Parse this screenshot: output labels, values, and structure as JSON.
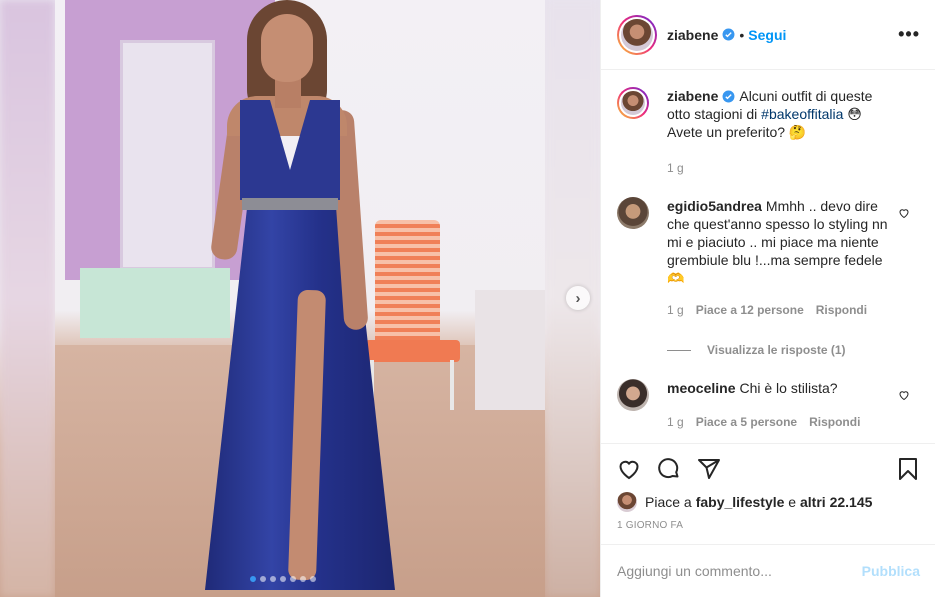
{
  "post": {
    "username": "ziabene",
    "follow_label": "Segui",
    "separator": "•",
    "more_label": "•••"
  },
  "caption": {
    "username": "ziabene",
    "text_before": "Alcuni outfit di queste otto stagioni di ",
    "hashtag": "#bakeoffitalia",
    "text_after": " 😳 Avete un preferito? 🤔",
    "time": "1 g"
  },
  "comments": [
    {
      "username": "egidio5andrea",
      "text": "Mmhh .. devo dire che quest'anno spesso lo styling nn mi e piaciuto .. mi piace ma niente grembiule blu !...ma sempre fedele🫶",
      "time": "1 g",
      "likes": "Piace a 12 persone",
      "reply_label": "Rispondi",
      "view_replies": "Visualizza le risposte (1)"
    },
    {
      "username": "meoceline",
      "text": "Chi è lo stilista?",
      "time": "1 g",
      "likes": "Piace a 5 persone",
      "reply_label": "Rispondi"
    }
  ],
  "likes": {
    "prefix": "Piace a ",
    "user": "faby_lifestyle",
    "middle": " e ",
    "others": "altri 22.145"
  },
  "timestamp": "1 GIORNO FA",
  "add_comment": {
    "placeholder": "Aggiungi un commento...",
    "post_label": "Pubblica"
  },
  "carousel": {
    "slide_count": 7,
    "active_index": 0,
    "next_label": "›"
  },
  "colors": {
    "link_blue": "#0095f6",
    "post_disabled": "#b2dffc",
    "dress_blue": "#2c3891"
  }
}
